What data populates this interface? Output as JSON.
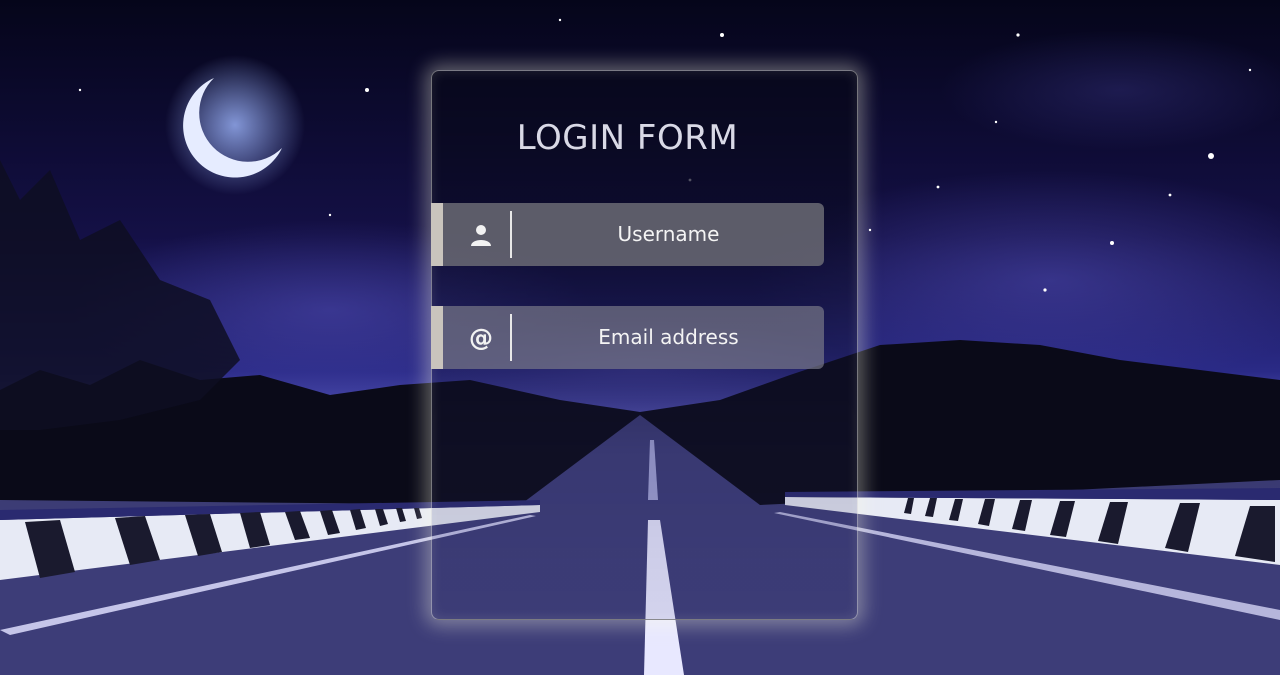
{
  "form": {
    "title": "LOGIN FORM",
    "username": {
      "placeholder": "Username",
      "icon": "user-icon"
    },
    "email": {
      "placeholder": "Email address",
      "icon": "at-icon",
      "icon_glyph": "@"
    }
  },
  "colors": {
    "sky_dark": "#0b0a2a",
    "field_bg": "#6e6e76",
    "field_accent": "#c9c4bd",
    "text": "#f4f4f4"
  }
}
